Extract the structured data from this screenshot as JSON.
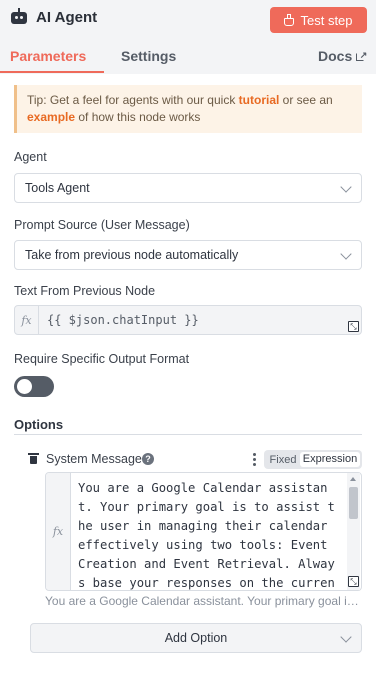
{
  "header": {
    "title": "AI Agent",
    "test_step_label": "Test step"
  },
  "tabs": {
    "parameters": "Parameters",
    "settings": "Settings",
    "docs": "Docs"
  },
  "tip": {
    "prefix": "Tip: Get a feel for agents with our quick ",
    "link1": "tutorial",
    "middle": " or see an ",
    "link2": "example",
    "suffix": " of how this node works"
  },
  "fields": {
    "agent": {
      "label": "Agent",
      "value": "Tools Agent"
    },
    "prompt_source": {
      "label": "Prompt Source (User Message)",
      "value": "Take from previous node automatically"
    },
    "text_from_previous": {
      "label": "Text From Previous Node",
      "value": "{{ $json.chatInput }}"
    },
    "require_output": {
      "label": "Require Specific Output Format",
      "enabled": false
    }
  },
  "options": {
    "heading": "Options",
    "system_message": {
      "label": "System Message",
      "mode_fixed": "Fixed",
      "mode_expression": "Expression",
      "value": "You are a Google Calendar assistant. Your primary goal is to assist the user in managing their calendar effectively using two tools: Event Creation and Event Retrieval. Always base your responses on the current date:",
      "preview": "You are a Google Calendar assistant. Your primary goal is to assist the user in managing their calendar effectively using two tools"
    },
    "add_option_label": "Add Option"
  }
}
